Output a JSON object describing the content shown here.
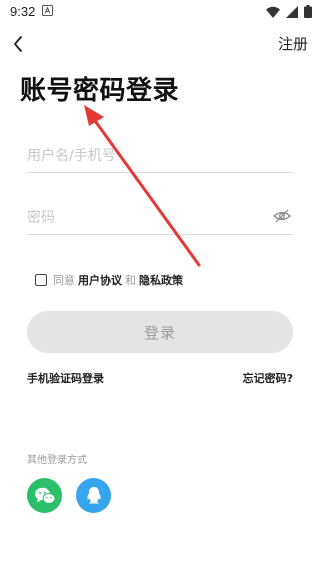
{
  "status_bar": {
    "time": "9:32",
    "notification_icon": "font-a-icon",
    "icons": [
      "wifi-icon",
      "signal-icon",
      "battery-icon"
    ]
  },
  "header": {
    "back_icon": "chevron-left-icon",
    "register_label": "注册"
  },
  "page_title": "账号密码登录",
  "form": {
    "username_placeholder": "用户名/手机号",
    "password_placeholder": "密码",
    "password_toggle_icon": "eye-off-icon"
  },
  "agreement": {
    "prefix": "同意",
    "user_agreement": "用户协议",
    "and": "和",
    "privacy_policy": "隐私政策",
    "checked": false
  },
  "login_button_label": "登录",
  "links": {
    "sms_login": "手机验证码登录",
    "forgot_password": "忘记密码?"
  },
  "other_login": {
    "label": "其他登录方式",
    "methods": [
      {
        "icon": "wechat-icon",
        "color": "#2bbf6a"
      },
      {
        "icon": "qq-icon",
        "color": "#35a6ee"
      }
    ]
  },
  "annotation": {
    "arrow_color": "#e53935"
  }
}
